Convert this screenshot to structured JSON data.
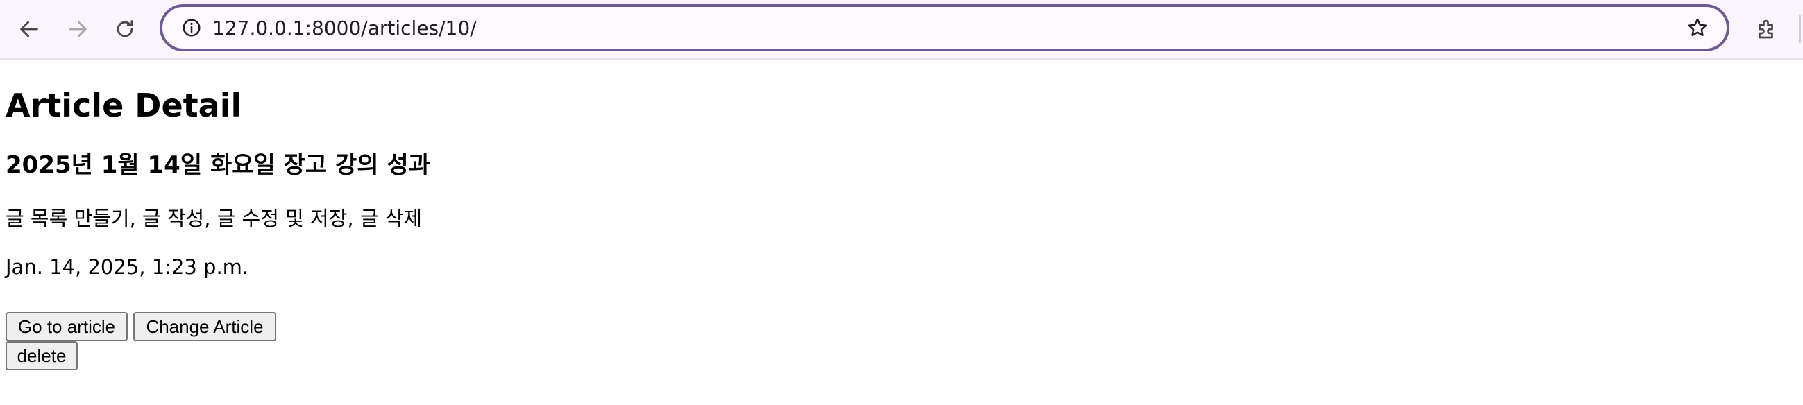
{
  "browser": {
    "url": "127.0.0.1:8000/articles/10/",
    "icons": {
      "back": "arrow-left-icon",
      "forward": "arrow-right-icon",
      "reload": "reload-icon",
      "site_info": "info-icon",
      "bookmark": "star-icon",
      "extensions": "puzzle-icon"
    },
    "colors": {
      "toolbar_bg": "#fbf6fd",
      "omnibox_border": "#6e5a92"
    }
  },
  "page": {
    "heading": "Article Detail",
    "article": {
      "title": "2025년 1월 14일 화요일 장고 강의 성과",
      "content": "글 목록 만들기, 글 작성, 글 수정 및 저장, 글 삭제",
      "created_at": "Jan. 14, 2025, 1:23 p.m."
    },
    "buttons": {
      "go_to_article": "Go to article",
      "change_article": "Change Article",
      "delete": "delete"
    }
  }
}
